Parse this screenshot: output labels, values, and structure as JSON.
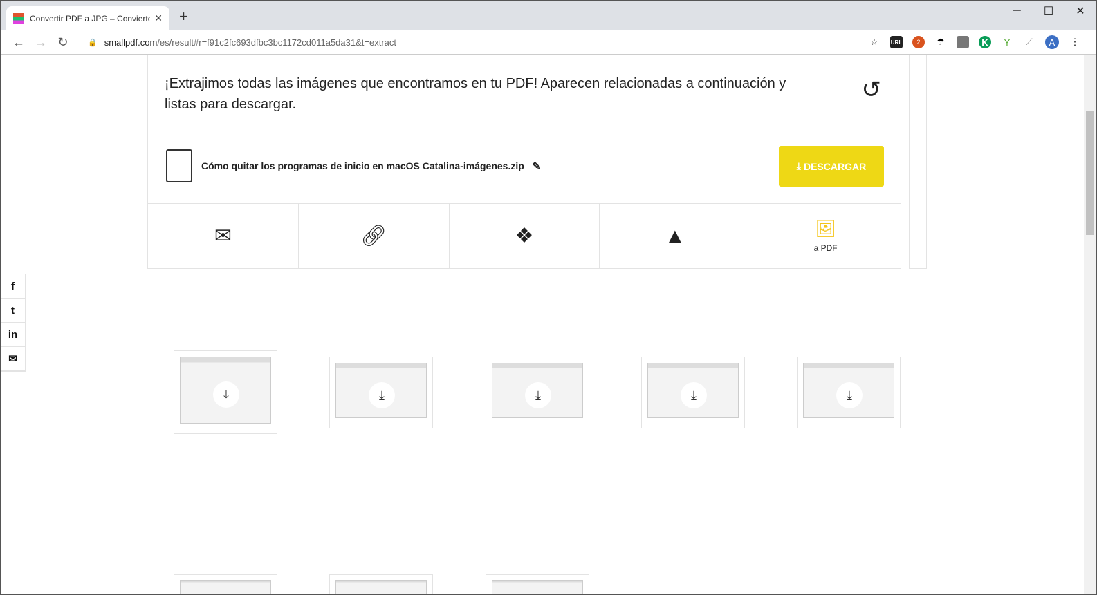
{
  "browser": {
    "tab_title": "Convertir PDF a JPG – Convierte",
    "url_host": "smallpdf.com",
    "url_path": "/es/result#r=f91c2fc693dfbc3bc1172cd011a5da31&t=extract",
    "ext_badge": "2",
    "avatar": "A",
    "ext_url_label": "URL"
  },
  "result": {
    "message": "¡Extrajimos todas las imágenes que encontramos en tu PDF! Aparecen relacionadas a continuación y listas para descargar.",
    "file_name": "Cómo quitar los programas de inicio en macOS Catalina-imágenes.zip",
    "download_label": "DESCARGAR",
    "to_pdf_label": "a PDF",
    "accent": "#eed815"
  },
  "social": [
    "f",
    "t",
    "in",
    "✉"
  ]
}
